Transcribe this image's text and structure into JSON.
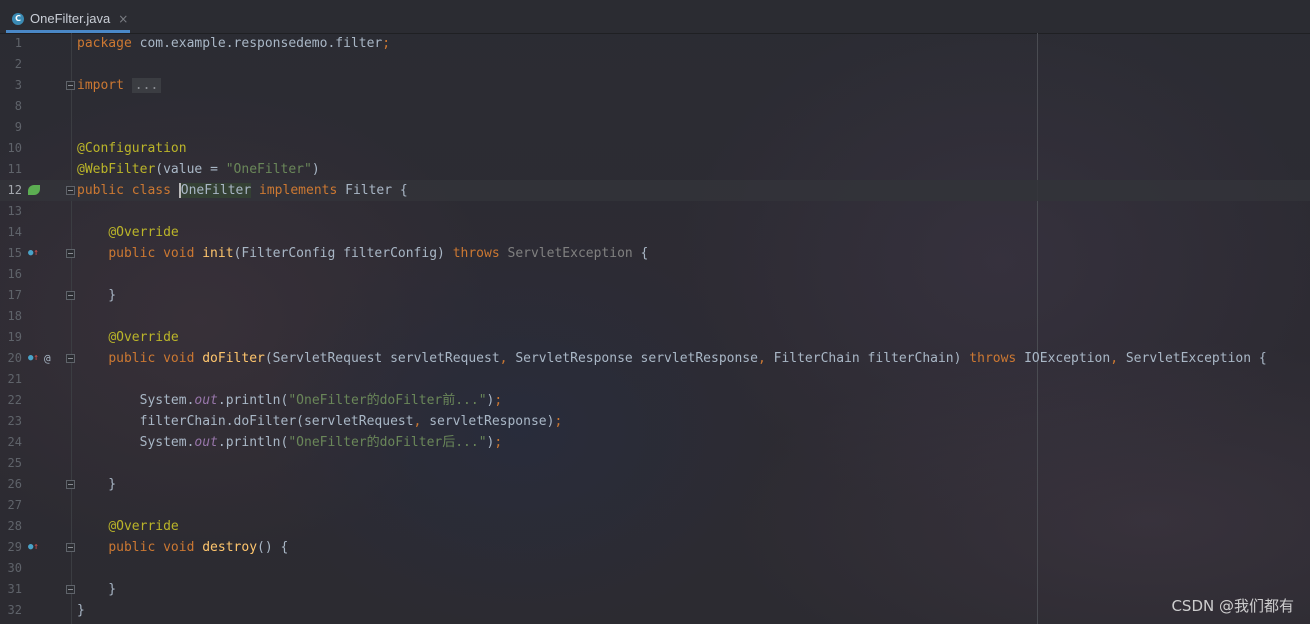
{
  "tab": {
    "icon": "java-class-icon",
    "icon_letter": "C",
    "label": "OneFilter.java",
    "close": "×"
  },
  "watermark": "CSDN @我们都有",
  "lines": [
    {
      "n": "1",
      "c": [
        [
          "kw",
          "package "
        ],
        [
          "",
          "com.example.responsedemo.filter"
        ],
        [
          "kw",
          ";"
        ]
      ]
    },
    {
      "n": "2",
      "c": []
    },
    {
      "n": "3",
      "c": [
        [
          "kw",
          "import "
        ],
        [
          "fold-ind",
          "..."
        ]
      ]
    },
    {
      "n": "8",
      "c": []
    },
    {
      "n": "9",
      "c": []
    },
    {
      "n": "10",
      "c": [
        [
          "ann",
          "@Configuration"
        ]
      ]
    },
    {
      "n": "11",
      "c": [
        [
          "ann",
          "@WebFilter"
        ],
        [
          "",
          "(value = "
        ],
        [
          "str",
          "\"OneFilter\""
        ],
        [
          "",
          ")"
        ]
      ]
    },
    {
      "n": "12",
      "c": [
        [
          "kw",
          "public class "
        ],
        [
          "caret hl-ident",
          "OneFilter"
        ],
        [
          "kw",
          " implements "
        ],
        [
          "",
          "Filter {"
        ]
      ]
    },
    {
      "n": "13",
      "c": []
    },
    {
      "n": "14",
      "c": [
        [
          "",
          "    "
        ],
        [
          "ann",
          "@Override"
        ]
      ]
    },
    {
      "n": "15",
      "c": [
        [
          "",
          "    "
        ],
        [
          "kw",
          "public void "
        ],
        [
          "fn",
          "init"
        ],
        [
          "",
          "(FilterConfig filterConfig) "
        ],
        [
          "kw",
          "throws "
        ],
        [
          "muted",
          "ServletException"
        ],
        [
          "",
          " {"
        ]
      ]
    },
    {
      "n": "16",
      "c": []
    },
    {
      "n": "17",
      "c": [
        [
          "",
          "    }"
        ]
      ]
    },
    {
      "n": "18",
      "c": []
    },
    {
      "n": "19",
      "c": [
        [
          "",
          "    "
        ],
        [
          "ann",
          "@Override"
        ]
      ]
    },
    {
      "n": "20",
      "c": [
        [
          "",
          "    "
        ],
        [
          "kw",
          "public void "
        ],
        [
          "fn",
          "doFilter"
        ],
        [
          "",
          "(ServletRequest servletRequest"
        ],
        [
          "kw",
          ", "
        ],
        [
          "",
          "ServletResponse servletResponse"
        ],
        [
          "kw",
          ", "
        ],
        [
          "",
          "FilterChain filterChain) "
        ],
        [
          "kw",
          "throws "
        ],
        [
          "",
          "IOException"
        ],
        [
          "kw",
          ", "
        ],
        [
          "",
          "ServletException {"
        ]
      ]
    },
    {
      "n": "21",
      "c": []
    },
    {
      "n": "22",
      "c": [
        [
          "",
          "        System."
        ],
        [
          "ital",
          "out"
        ],
        [
          "",
          ".println("
        ],
        [
          "str",
          "\"OneFilter的doFilter前...\""
        ],
        [
          "",
          ")"
        ],
        [
          "kw",
          ";"
        ]
      ]
    },
    {
      "n": "23",
      "c": [
        [
          "",
          "        filterChain.doFilter(servletRequest"
        ],
        [
          "kw",
          ", "
        ],
        [
          "",
          "servletResponse)"
        ],
        [
          "kw",
          ";"
        ]
      ]
    },
    {
      "n": "24",
      "c": [
        [
          "",
          "        System."
        ],
        [
          "ital",
          "out"
        ],
        [
          "",
          ".println("
        ],
        [
          "str",
          "\"OneFilter的doFilter后...\""
        ],
        [
          "",
          ")"
        ],
        [
          "kw",
          ";"
        ]
      ]
    },
    {
      "n": "25",
      "c": []
    },
    {
      "n": "26",
      "c": [
        [
          "",
          "    }"
        ]
      ]
    },
    {
      "n": "27",
      "c": []
    },
    {
      "n": "28",
      "c": [
        [
          "",
          "    "
        ],
        [
          "ann",
          "@Override"
        ]
      ]
    },
    {
      "n": "29",
      "c": [
        [
          "",
          "    "
        ],
        [
          "kw",
          "public void "
        ],
        [
          "fn",
          "destroy"
        ],
        [
          "",
          "() {"
        ]
      ]
    },
    {
      "n": "30",
      "c": []
    },
    {
      "n": "31",
      "c": [
        [
          "",
          "    }"
        ]
      ]
    },
    {
      "n": "32",
      "c": [
        [
          "",
          "}"
        ]
      ]
    }
  ],
  "current_line": "12",
  "gutter_icons": {
    "12": [
      "spring-bean-icon"
    ],
    "15": [
      "implements-method-icon"
    ],
    "20": [
      "implements-method-icon",
      "annotation-at-icon"
    ],
    "29": [
      "implements-method-icon"
    ]
  },
  "fold_markers": [
    "3",
    "12",
    "15",
    "17",
    "20",
    "26",
    "29",
    "31"
  ]
}
